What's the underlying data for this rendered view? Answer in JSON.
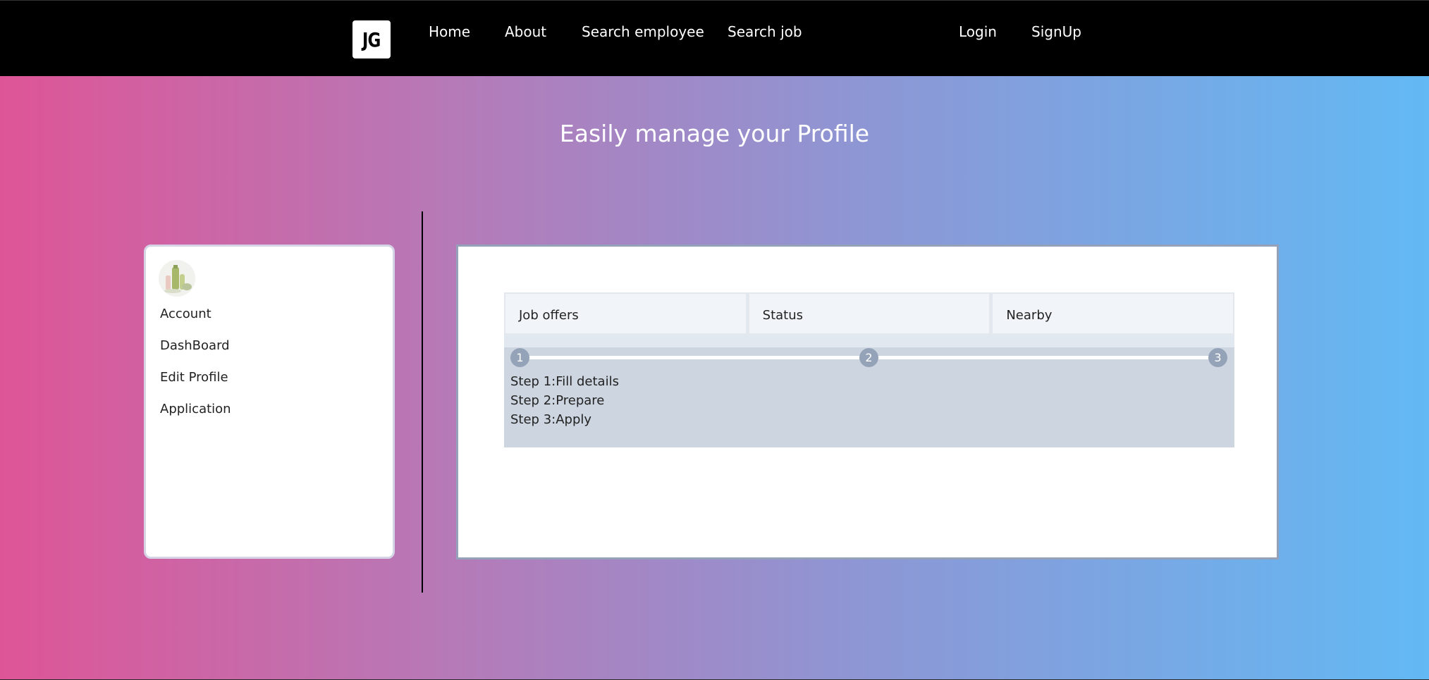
{
  "navbar": {
    "logo_text": "JG",
    "links": {
      "home": "Home",
      "about": "About",
      "search_employee": "Search employee",
      "search_job": "Search job",
      "login": "Login",
      "signup": "SignUp"
    }
  },
  "hero": {
    "title": "Easily manage your Profile"
  },
  "sidebar": {
    "items": {
      "account": "Account",
      "dashboard": "DashBoard",
      "edit_profile": "Edit Profile",
      "application": "Application"
    }
  },
  "panel": {
    "tabs": [
      "Job offers",
      "Status",
      "Nearby"
    ],
    "progress": {
      "markers": [
        "1",
        "2",
        "3"
      ]
    },
    "steps": [
      "Step 1:Fill details",
      "Step 2:Prepare",
      "Step 3:Apply"
    ]
  },
  "colors": {
    "navbar_bg": "#000000",
    "gradient_start": "#de5597",
    "gradient_end": "#62b9f4",
    "step_marker": "#94a3b8",
    "steps_bg": "#cdd5e0"
  }
}
